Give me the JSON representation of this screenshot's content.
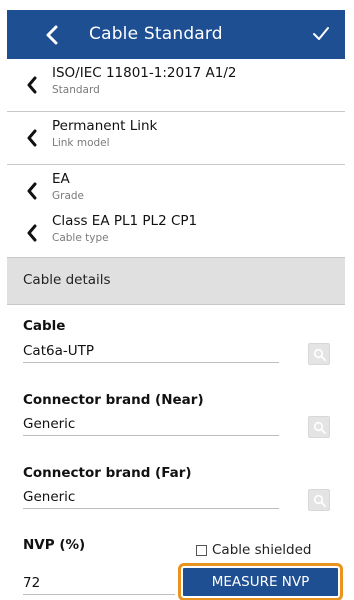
{
  "header": {
    "title": "Cable Standard",
    "back_icon": "chevron-left-icon",
    "confirm_icon": "check-icon",
    "color": "#1f4f93"
  },
  "selections": [
    {
      "value": "ISO/IEC 11801-1:2017 A1/2",
      "caption": "Standard"
    },
    {
      "value": "Permanent Link",
      "caption": "Link model"
    },
    {
      "value": "EA",
      "caption": "Grade"
    },
    {
      "value": "Class EA PL1 PL2 CP1",
      "caption": "Cable type"
    }
  ],
  "section": {
    "title": "Cable details"
  },
  "fields": {
    "cable": {
      "label": "Cable",
      "value": "Cat6a-UTP"
    },
    "connector_near": {
      "label": "Connector brand (Near)",
      "value": "Generic"
    },
    "connector_far": {
      "label": "Connector brand (Far)",
      "value": "Generic"
    },
    "nvp": {
      "label": "NVP (%)",
      "value": "72"
    }
  },
  "cable_shielded": {
    "label": "Cable shielded",
    "checked": false
  },
  "measure_button": {
    "label": "MEASURE NVP",
    "highlight_color": "#e8941f"
  }
}
